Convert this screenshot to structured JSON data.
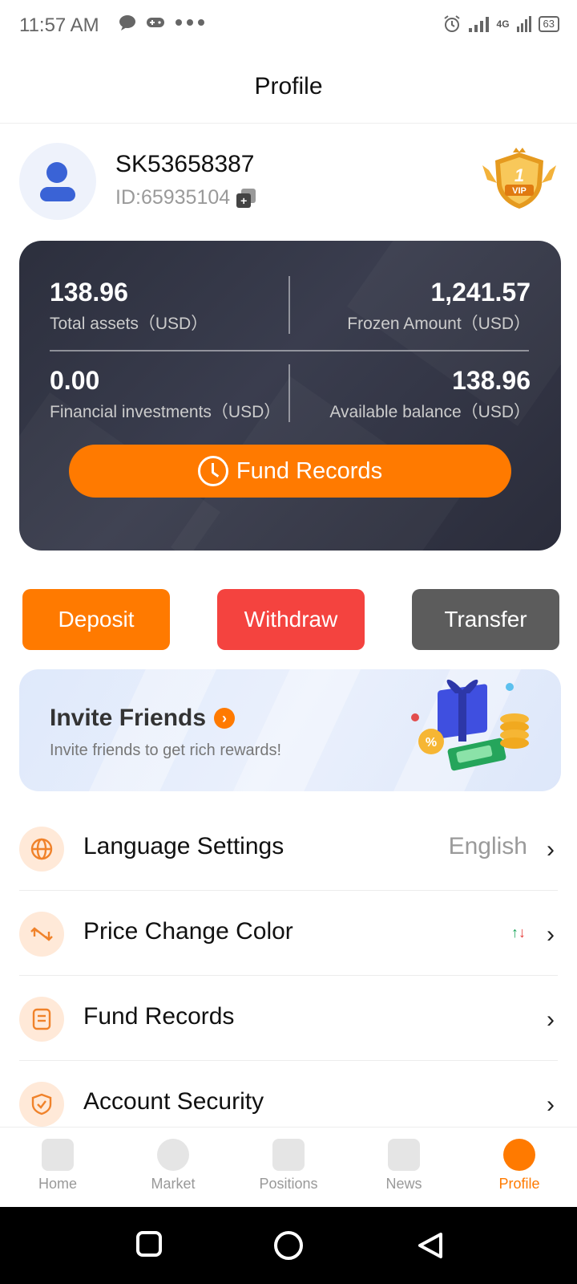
{
  "status_bar": {
    "time": "11:57 AM",
    "battery": "63",
    "network": "4G"
  },
  "header": {
    "title": "Profile"
  },
  "user": {
    "name": "SK53658387",
    "id": "ID:65935104",
    "vip_level": "1",
    "vip_label": "VIP"
  },
  "assets": {
    "total_value": "138.96",
    "total_label": "Total assets（USD）",
    "frozen_value": "1,241.57",
    "frozen_label": "Frozen Amount（USD）",
    "financial_value": "0.00",
    "financial_label": "Financial investments（USD）",
    "available_value": "138.96",
    "available_label": "Available balance（USD）",
    "fund_records_button": "Fund Records"
  },
  "actions": {
    "deposit": "Deposit",
    "withdraw": "Withdraw",
    "transfer": "Transfer"
  },
  "invite": {
    "title": "Invite Friends",
    "subtitle": "Invite friends to get rich rewards!"
  },
  "settings": {
    "language_label": "Language Settings",
    "language_value": "English",
    "price_color_label": "Price Change Color",
    "fund_records_label": "Fund Records",
    "security_label": "Account Security"
  },
  "bottom_nav": {
    "home": "Home",
    "market": "Market",
    "positions": "Positions",
    "news": "News",
    "profile": "Profile"
  },
  "colors": {
    "accent": "#ff7a00",
    "withdraw": "#f4433f",
    "transfer": "#5c5c5c",
    "card": "#2c2f3d"
  }
}
